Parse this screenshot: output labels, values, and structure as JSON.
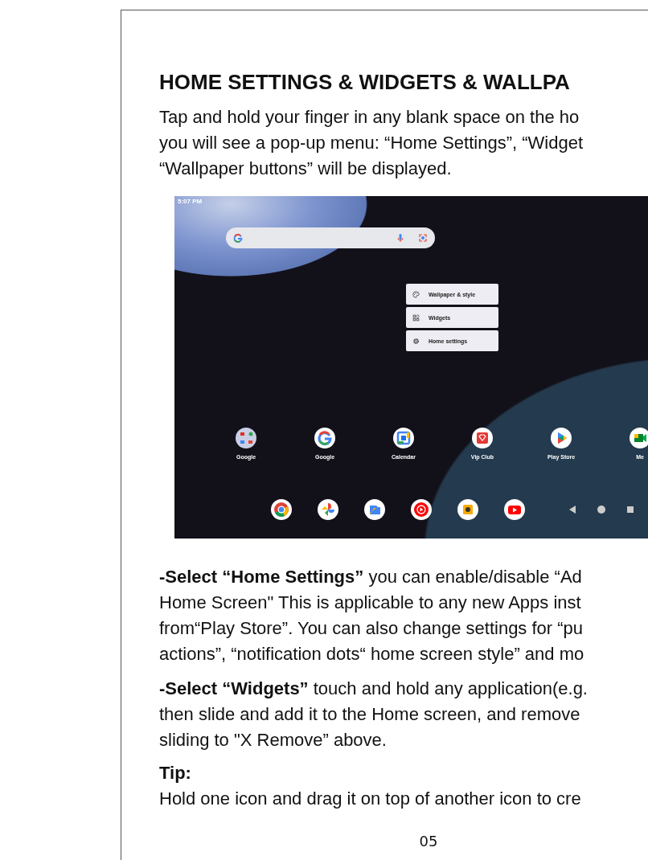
{
  "heading": "HOME SETTINGS & WIDGETS & WALLPA",
  "intro": [
    "Tap and hold your finger in any blank space on the ho",
    "you will see a pop-up menu: “Home Settings”, “Widget",
    "“Wallpaper buttons” will be displayed."
  ],
  "screenshot": {
    "status_time": "5:07 PM",
    "menu": [
      {
        "label": "Wallpaper & style",
        "kind": "palette"
      },
      {
        "label": "Widgets",
        "kind": "grid"
      },
      {
        "label": "Home settings",
        "kind": "gear"
      }
    ],
    "apps": [
      {
        "label": "Google",
        "kind": "folder"
      },
      {
        "label": "Google",
        "kind": "g"
      },
      {
        "label": "Calendar",
        "kind": "calendar"
      },
      {
        "label": "Vip Club",
        "kind": "gem"
      },
      {
        "label": "Play Store",
        "kind": "play"
      },
      {
        "label": "Me",
        "kind": "meet"
      }
    ],
    "dock": [
      {
        "kind": "chrome"
      },
      {
        "kind": "pinwheel"
      },
      {
        "kind": "files"
      },
      {
        "kind": "music"
      },
      {
        "kind": "speaker"
      },
      {
        "kind": "video"
      }
    ]
  },
  "paragraphs": [
    [
      "**-Select “Home Settings”** you can enable/disable “Ad",
      "Home Screen\" This is applicable to any new Apps inst",
      "from“Play Store”. You can also change settings for “pu",
      "actions”, “notification dots“ home screen style” and mo"
    ],
    [
      "**-Select “Widgets”** touch and hold any application(e.g.",
      "then slide and add it to the Home screen, and remove",
      "sliding to \"X Remove” above."
    ]
  ],
  "tip": {
    "title": "Tip:",
    "lines": [
      "Hold one icon and drag it on top of another icon to cre"
    ]
  },
  "page_number": "05"
}
